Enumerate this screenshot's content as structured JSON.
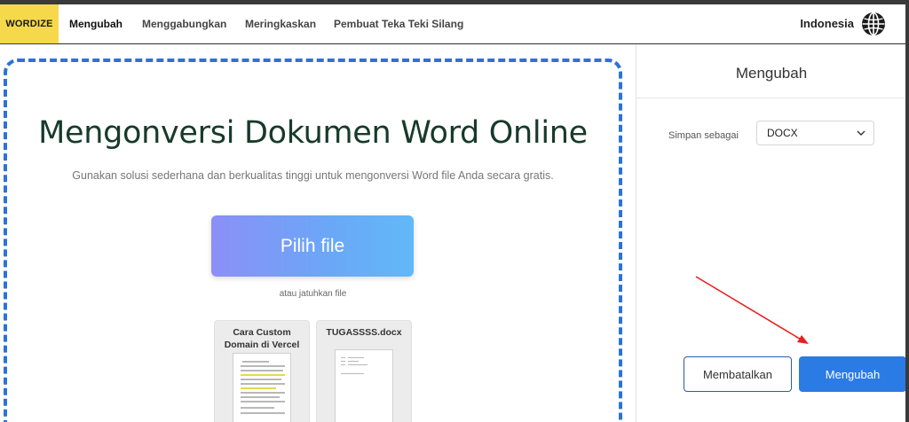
{
  "navbar": {
    "logo": "WORDIZE",
    "items": [
      {
        "label": "Mengubah",
        "active": true
      },
      {
        "label": "Menggabungkan",
        "active": false
      },
      {
        "label": "Meringkaskan",
        "active": false
      },
      {
        "label": "Pembuat Teka Teki Silang",
        "active": false
      }
    ],
    "language": "Indonesia",
    "language_icon": "globe-icon"
  },
  "main": {
    "title": "Mengonversi Dokumen Word Online",
    "subtitle": "Gunakan solusi sederhana dan berkualitas tinggi untuk mengonversi Word file Anda secara gratis.",
    "pick_file_label": "Pilih file",
    "drop_text": "atau jatuhkan file",
    "files": [
      {
        "name": "Cara Custom Domain di Vercel"
      },
      {
        "name": "TUGASSSS.docx"
      }
    ]
  },
  "sidebar": {
    "title": "Mengubah",
    "save_as_label": "Simpan sebagai",
    "format_value": "DOCX",
    "cancel_label": "Membatalkan",
    "convert_label": "Mengubah"
  },
  "colors": {
    "brand_yellow": "#f6d94a",
    "accent_blue": "#2b7be4",
    "dash_border": "#2b73d8",
    "annotation_arrow": "#e82020"
  }
}
